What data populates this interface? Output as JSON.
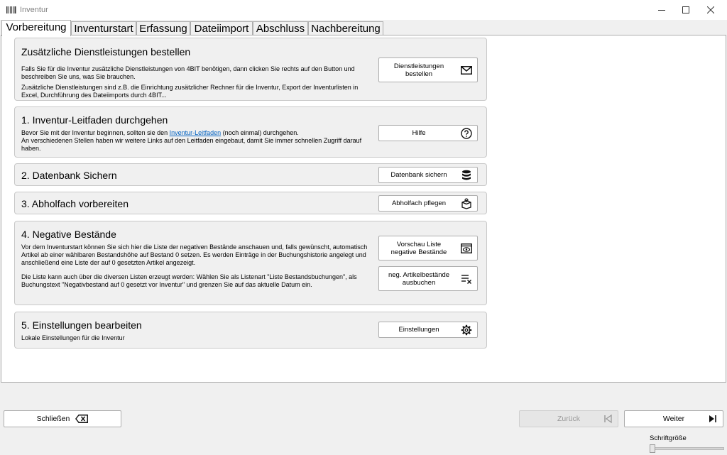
{
  "window": {
    "title": "Inventur"
  },
  "tabs": [
    {
      "label": "Vorbereitung",
      "active": true
    },
    {
      "label": "Inventurstart"
    },
    {
      "label": "Erfassung"
    },
    {
      "label": "Dateiimport"
    },
    {
      "label": "Abschluss"
    },
    {
      "label": "Nachbereitung"
    }
  ],
  "sections": {
    "services": {
      "title": "Zusätzliche Dienstleistungen bestellen",
      "desc1": "Falls Sie für die Inventur zusätzliche Dienstleistungen von 4BIT benötigen, dann clicken Sie rechts auf den Button und beschreiben Sie uns, was Sie brauchen.",
      "desc2": "Zusätzliche Dienstleistungen sind z.B. die Einrichtung zusätzlicher Rechner für die Inventur, Export der Inventurlisten in Excel, Durchführung des Dateiimports durch 4BIT...",
      "button_line1": "Dienstleistungen",
      "button_line2": "bestellen",
      "button_icon": "envelope-icon"
    },
    "guide": {
      "title": "1. Inventur-Leitfaden durchgehen",
      "desc_before_link": "Bevor Sie mit der Inventur beginnen, sollten sie den ",
      "desc_link": "Inventur-Leitfaden",
      "desc_after_link": " (noch einmal) durchgehen.",
      "desc2": "An verschiedenen Stellen haben wir weitere Links auf den Leitfaden eingebaut, damit Sie immer schnellen Zugriff darauf haben.",
      "button": "Hilfe",
      "button_icon": "help-circle-icon"
    },
    "backup": {
      "title": "2. Datenbank Sichern",
      "button": "Datenbank sichern",
      "button_icon": "database-icon"
    },
    "pickup": {
      "title": "3. Abholfach vorbereiten",
      "button": "Abholfach pflegen",
      "button_icon": "package-icon"
    },
    "negative": {
      "title": "4. Negative Bestände",
      "desc1": "Vor dem Inventurstart können Sie sich hier die Liste der negativen Bestände anschauen und, falls gewünscht, automatisch Artikel ab einer wählbaren Bestandshöhe auf Bestand 0 setzen. Es werden Einträge in der Buchungshistorie angelegt und anschließend eine Liste der auf 0 gesetzten Artikel angezeigt.",
      "desc2": "Die Liste kann auch über die diversen Listen erzeugt werden: Wählen Sie als Listenart \"Liste Bestandsbuchungen\", als Buchungstext \"Negativbestand auf 0 gesetzt vor Inventur\" und grenzen Sie auf das aktuelle Datum ein.",
      "button1_line1": "Vorschau Liste",
      "button1_line2": "negative Bestände",
      "button1_icon": "preview-icon",
      "button2_line1": "neg. Artikelbestände",
      "button2_line2": "ausbuchen",
      "button2_icon": "clear-list-icon"
    },
    "settings": {
      "title": "5. Einstellungen bearbeiten",
      "desc": "Lokale Einstellungen für die Inventur",
      "button": "Einstellungen",
      "button_icon": "gear-icon"
    }
  },
  "footer": {
    "close": "Schließen",
    "back": "Zurück",
    "next": "Weiter",
    "font_size_label": "Schriftgröße",
    "font_size_level": 0
  }
}
